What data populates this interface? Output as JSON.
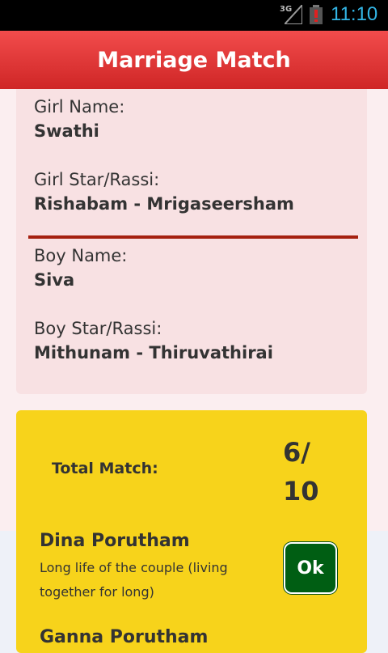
{
  "status_bar": {
    "network": "3G",
    "time": "11:10"
  },
  "app_bar": {
    "title": "Marriage Match"
  },
  "girl": {
    "name_label": "Girl Name:",
    "name": "Swathi",
    "star_label": "Girl Star/Rassi:",
    "star": "Rishabam - Mrigaseersham"
  },
  "boy": {
    "name_label": "Boy Name:",
    "name": "Siva",
    "star_label": "Boy Star/Rassi:",
    "star": "Mithunam - Thiruvathirai"
  },
  "match": {
    "total_label": "Total Match:",
    "total_value": "6/ 10",
    "poruthams": [
      {
        "title": "Dina Porutham",
        "description": "Long life of the couple (living together for long)",
        "result": "Ok"
      },
      {
        "title": "Ganna Porutham"
      }
    ]
  },
  "colors": {
    "app_bar": "#e03a3a",
    "match_card": "#f7d31b",
    "ok_button": "#005e13",
    "divider": "#a52010"
  }
}
